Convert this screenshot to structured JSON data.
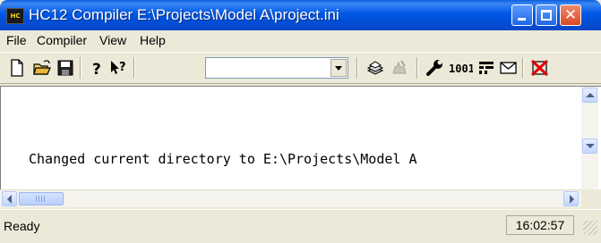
{
  "window": {
    "title": "HC12 Compiler  E:\\Projects\\Model A\\project.ini",
    "app_icon_text": "HC",
    "controls": {
      "minimize": "minimize-icon",
      "maximize": "maximize-icon",
      "close": "close-icon"
    }
  },
  "menu": {
    "items": [
      {
        "label": "File"
      },
      {
        "label": "Compiler"
      },
      {
        "label": "View"
      },
      {
        "label": "Help"
      }
    ]
  },
  "toolbar": {
    "buttons": [
      {
        "icon": "new-file-icon"
      },
      {
        "icon": "open-folder-icon"
      },
      {
        "icon": "save-icon"
      },
      {
        "icon": "help-icon"
      },
      {
        "icon": "context-help-icon"
      },
      {
        "icon": "compile-icon"
      },
      {
        "icon": "stop-compile-icon"
      },
      {
        "icon": "options-wrench-icon"
      },
      {
        "icon": "options-bits-icon"
      },
      {
        "icon": "messages-settings-icon"
      },
      {
        "icon": "mail-icon"
      },
      {
        "icon": "disabled-red-icon"
      }
    ],
    "combo_value": ""
  },
  "output": {
    "lines": [
      "Changed current directory to E:\\Projects\\Model A"
    ]
  },
  "status": {
    "text": "Ready",
    "time": "16:02:57"
  },
  "colors": {
    "titlebar": "#0058e6",
    "window_bg": "#ece9d8",
    "close_button": "#d94a22"
  }
}
